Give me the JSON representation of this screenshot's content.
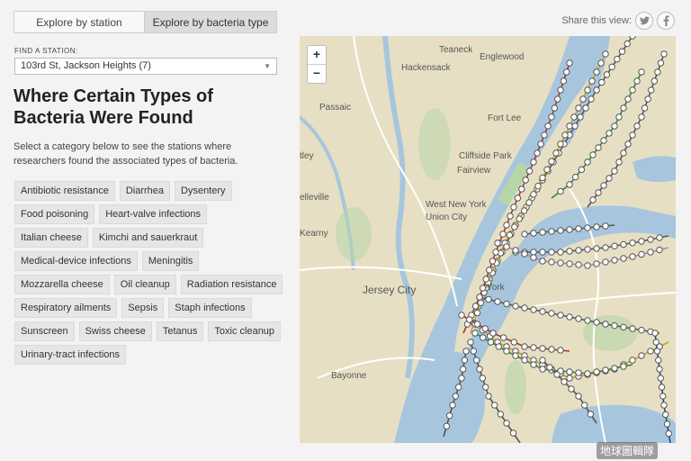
{
  "tabs": [
    {
      "label": "Explore by station"
    },
    {
      "label": "Explore by bacteria type"
    }
  ],
  "find_station": {
    "label": "FIND A STATION:",
    "selected": "103rd St, Jackson Heights (7)"
  },
  "heading": "Where Certain Types of Bacteria Were Found",
  "description": "Select a category below to see the stations where researchers found the associated types of bacteria.",
  "categories": [
    "Antibiotic resistance",
    "Diarrhea",
    "Dysentery",
    "Food poisoning",
    "Heart-valve infections",
    "Italian cheese",
    "Kimchi and sauerkraut",
    "Medical-device infections",
    "Meningitis",
    "Mozzarella cheese",
    "Oil cleanup",
    "Radiation resistance",
    "Respiratory ailments",
    "Sepsis",
    "Staph infections",
    "Sunscreen",
    "Swiss cheese",
    "Tetanus",
    "Toxic cleanup",
    "Urinary-tract infections"
  ],
  "share": {
    "label": "Share this view:",
    "twitter_icon": "twitter-icon",
    "facebook_icon": "facebook-icon"
  },
  "map": {
    "zoom_in": "+",
    "zoom_out": "−",
    "places": [
      {
        "name": "Teaneck"
      },
      {
        "name": "Englewood"
      },
      {
        "name": "Hackensack"
      },
      {
        "name": "Passaic"
      },
      {
        "name": "Fort Lee"
      },
      {
        "name": "Cliffside Park"
      },
      {
        "name": "Fairview"
      },
      {
        "name": "tley"
      },
      {
        "name": "elleville"
      },
      {
        "name": "West New York"
      },
      {
        "name": "Union City"
      },
      {
        "name": "Kearny"
      },
      {
        "name": "Jersey City"
      },
      {
        "name": "York"
      },
      {
        "name": "Bayonne"
      }
    ],
    "colors": {
      "land": "#e7dfc4",
      "water": "#a7c6dd",
      "park": "#b6d6a6",
      "station": "#ffffff",
      "line": "#555555"
    }
  },
  "watermark": "地球圖輯隊"
}
